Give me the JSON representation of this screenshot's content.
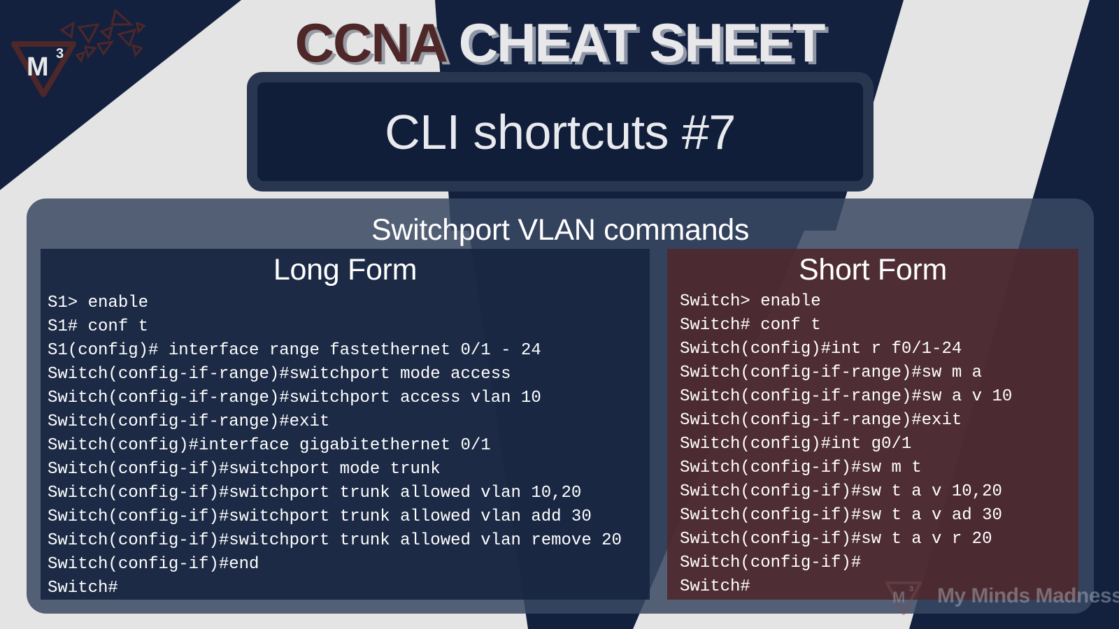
{
  "header": {
    "title_part1": "CCNA",
    "title_part2": "CHEAT SHEET"
  },
  "logo": {
    "text": "M",
    "superscript": "3"
  },
  "subtitle": "CLI shortcuts #7",
  "section_title": "Switchport VLAN commands",
  "long_form": {
    "title": "Long Form",
    "commands": [
      "S1> enable",
      "S1# conf t",
      "S1(config)# interface range fastethernet 0/1 - 24",
      "Switch(config-if-range)#switchport mode access",
      "Switch(config-if-range)#switchport access vlan 10",
      "Switch(config-if-range)#exit",
      "Switch(config)#interface gigabitethernet 0/1",
      "Switch(config-if)#switchport mode trunk",
      "Switch(config-if)#switchport trunk allowed vlan 10,20",
      "Switch(config-if)#switchport trunk allowed vlan add 30",
      "Switch(config-if)#switchport trunk allowed vlan remove 20",
      "Switch(config-if)#end",
      "Switch#"
    ]
  },
  "short_form": {
    "title": "Short Form",
    "commands": [
      "Switch> enable",
      "Switch# conf t",
      "Switch(config)#int r f0/1-24",
      "Switch(config-if-range)#sw m a",
      "Switch(config-if-range)#sw a v 10",
      "Switch(config-if-range)#exit",
      "Switch(config)#int g0/1",
      "Switch(config-if)#sw m t",
      "Switch(config-if)#sw t a v 10,20",
      "Switch(config-if)#sw t a v ad 30",
      "Switch(config-if)#sw t a v r 20",
      "Switch(config-if)#",
      "Switch#"
    ]
  },
  "branding": {
    "text": "My Minds Madness",
    "logo_text": "M",
    "logo_superscript": "3"
  },
  "colors": {
    "navy": "#13213f",
    "light_gray": "#e4e4e5",
    "maroon": "#4e2729",
    "short_form_bg": "#4e282e",
    "long_form_bg": "#182642"
  }
}
